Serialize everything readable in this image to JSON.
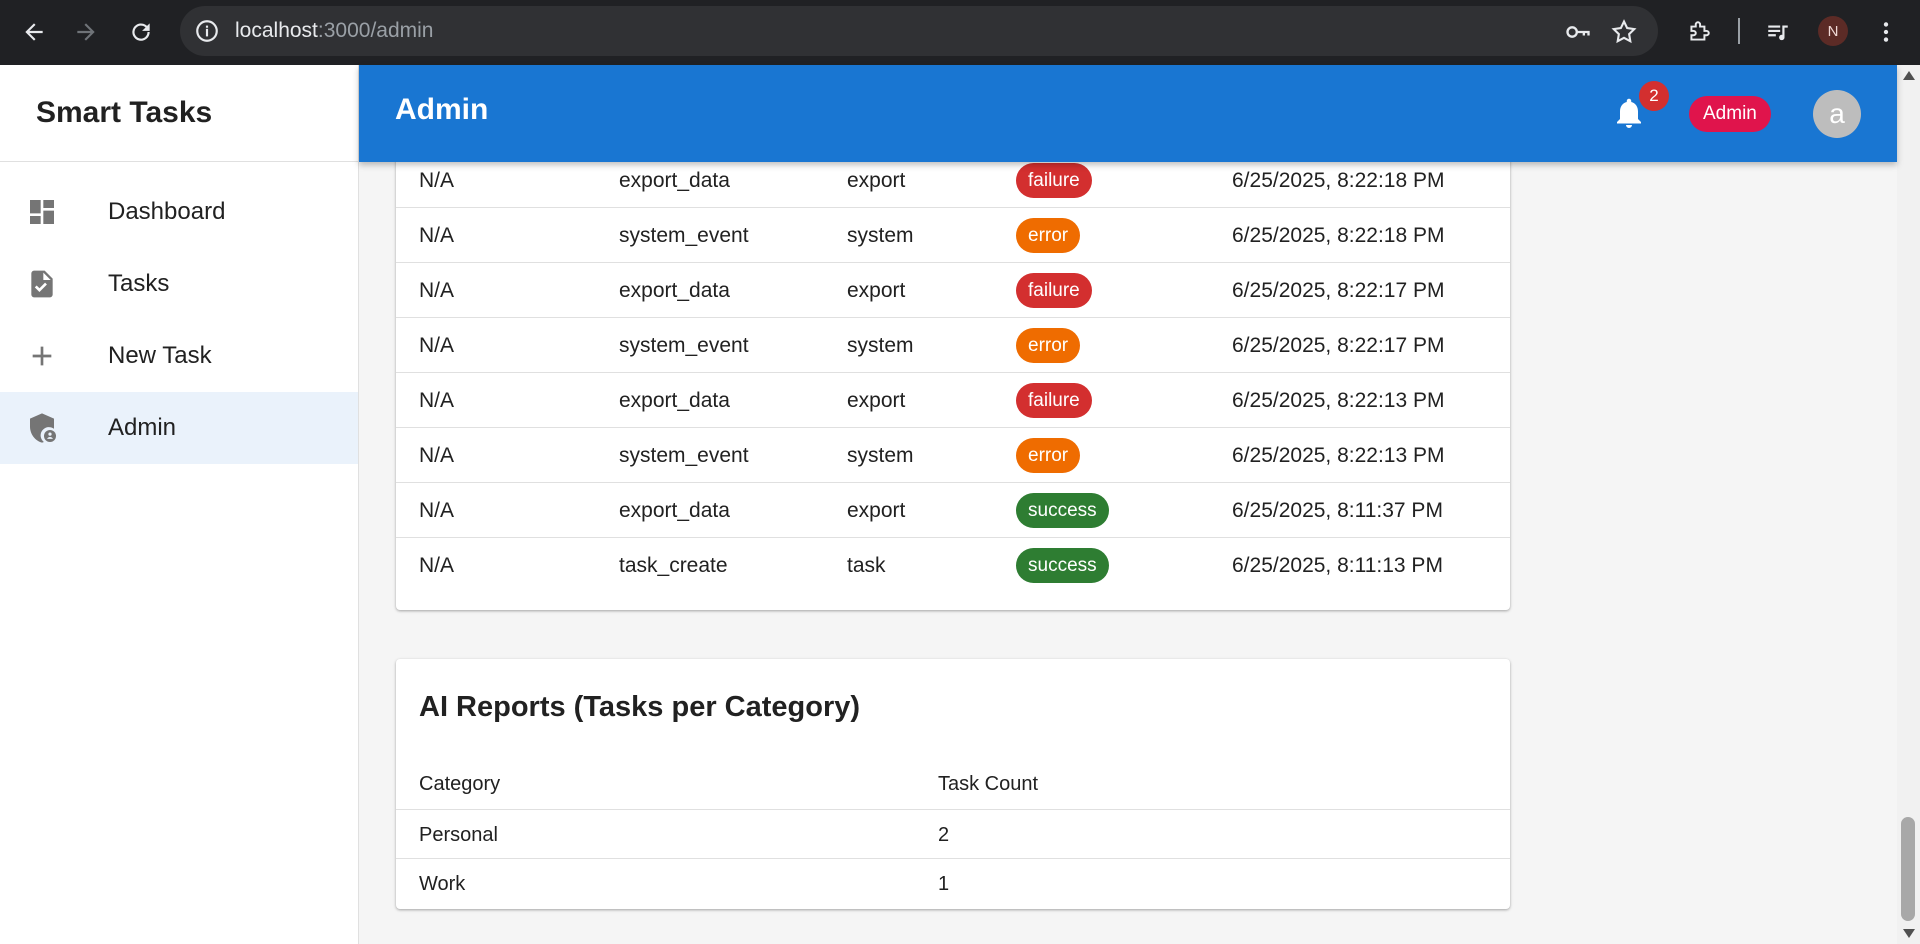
{
  "browser": {
    "url_host": "localhost",
    "url_path": ":3000/admin",
    "profile_initial": "N"
  },
  "sidebar": {
    "brand": "Smart Tasks",
    "items": [
      {
        "label": "Dashboard",
        "icon": "dashboard-icon"
      },
      {
        "label": "Tasks",
        "icon": "task-file-icon"
      },
      {
        "label": "New Task",
        "icon": "plus-icon"
      },
      {
        "label": "Admin",
        "icon": "admin-shield-icon",
        "active": true
      }
    ]
  },
  "appbar": {
    "title": "Admin",
    "notification_count": "2",
    "role_chip": "Admin",
    "avatar_initial": "a"
  },
  "colors": {
    "primary": "#1976d2",
    "failure": "#d32f2f",
    "error": "#ef6c00",
    "success": "#2e7d32",
    "role_chip": "#e0144c"
  },
  "logs": {
    "rows": [
      {
        "user": "N/A",
        "action": "export_data",
        "category": "export",
        "status": "failure",
        "timestamp": "6/25/2025, 8:22:18 PM"
      },
      {
        "user": "N/A",
        "action": "system_event",
        "category": "system",
        "status": "error",
        "timestamp": "6/25/2025, 8:22:18 PM"
      },
      {
        "user": "N/A",
        "action": "export_data",
        "category": "export",
        "status": "failure",
        "timestamp": "6/25/2025, 8:22:17 PM"
      },
      {
        "user": "N/A",
        "action": "system_event",
        "category": "system",
        "status": "error",
        "timestamp": "6/25/2025, 8:22:17 PM"
      },
      {
        "user": "N/A",
        "action": "export_data",
        "category": "export",
        "status": "failure",
        "timestamp": "6/25/2025, 8:22:13 PM"
      },
      {
        "user": "N/A",
        "action": "system_event",
        "category": "system",
        "status": "error",
        "timestamp": "6/25/2025, 8:22:13 PM"
      },
      {
        "user": "N/A",
        "action": "export_data",
        "category": "export",
        "status": "success",
        "timestamp": "6/25/2025, 8:11:37 PM"
      },
      {
        "user": "N/A",
        "action": "task_create",
        "category": "task",
        "status": "success",
        "timestamp": "6/25/2025, 8:11:13 PM"
      }
    ]
  },
  "reports": {
    "title": "AI Reports (Tasks per Category)",
    "headers": [
      "Category",
      "Task Count"
    ],
    "rows": [
      {
        "category": "Personal",
        "count": "2"
      },
      {
        "category": "Work",
        "count": "1"
      }
    ]
  }
}
